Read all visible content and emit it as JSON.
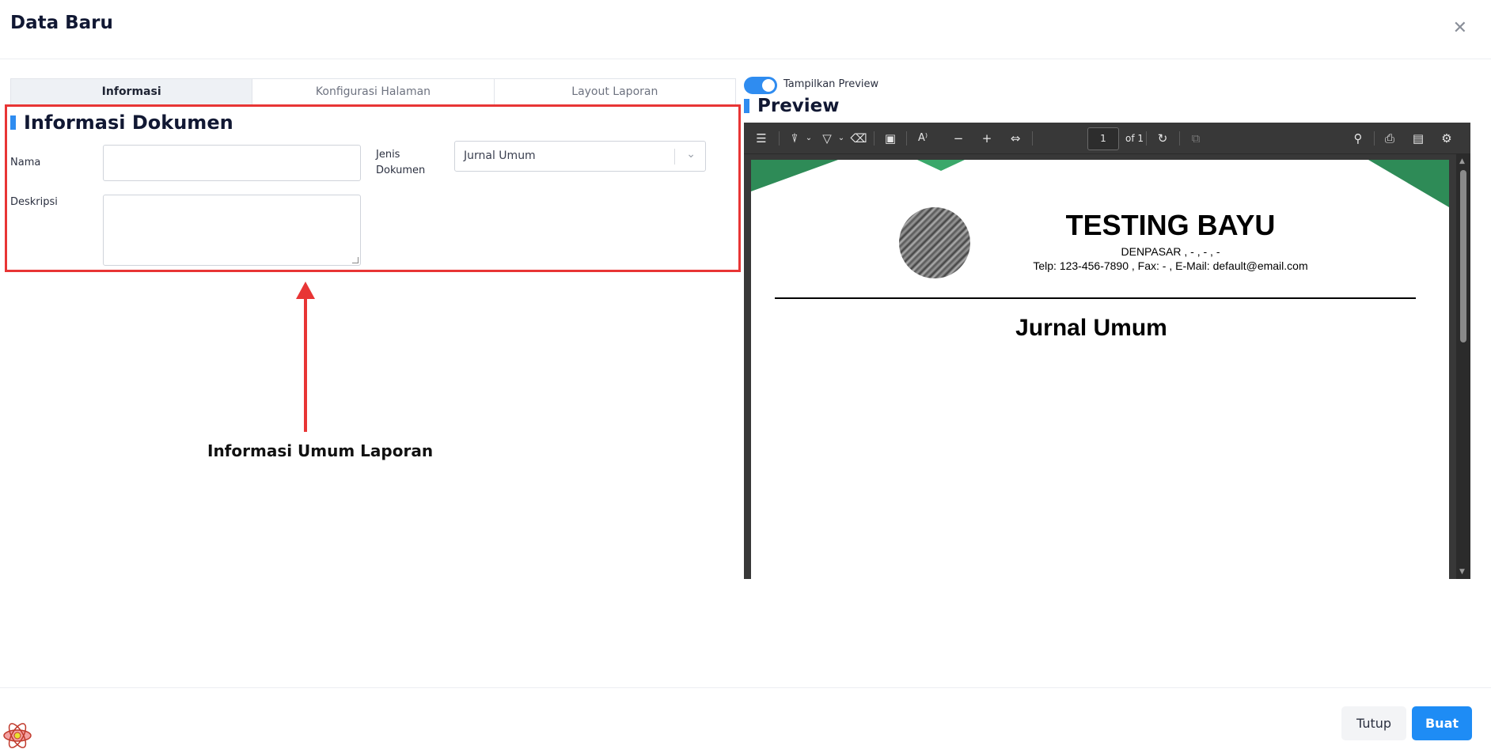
{
  "modal": {
    "title": "Data Baru"
  },
  "tabs": [
    {
      "label": "Informasi",
      "active": true
    },
    {
      "label": "Konfigurasi Halaman",
      "active": false
    },
    {
      "label": "Layout Laporan",
      "active": false
    }
  ],
  "section": {
    "title": "Informasi Dokumen",
    "fields": {
      "nama_label": "Nama",
      "nama_value": "",
      "deskripsi_label": "Deskripsi",
      "deskripsi_value": "",
      "jenis_label_line1": "Jenis",
      "jenis_label_line2": "Dokumen",
      "jenis_value": "Jurnal Umum"
    }
  },
  "annotation": {
    "label": "Informasi Umum Laporan",
    "color": "#e83535"
  },
  "preview": {
    "toggle_label": "Tampilkan Preview",
    "toggle_on": true,
    "title": "Preview",
    "viewer": {
      "page_current": "1",
      "page_total": "of 1",
      "toolbar_icons": [
        "sidebar-icon",
        "highlight-icon",
        "underline-icon",
        "eraser-icon",
        "text-box-icon",
        "read-aloud-icon",
        "zoom-out-icon",
        "zoom-in-icon",
        "fit-page-icon",
        "rotate-icon",
        "two-page-icon",
        "search-icon",
        "print-icon",
        "save-icon",
        "settings-icon"
      ]
    },
    "document": {
      "company": "TESTING BAYU",
      "address": "DENPASAR , - , - , -",
      "contact": "Telp:  123-456-7890 , Fax:  - , E-Mail:  default@email.com",
      "title": "Jurnal Umum"
    }
  },
  "footer": {
    "tutup_label": "Tutup",
    "buat_label": "Buat"
  },
  "colors": {
    "accent": "#2f8cf0",
    "primary_button": "#1e8cf5",
    "banner_green": "#2e8b57"
  }
}
